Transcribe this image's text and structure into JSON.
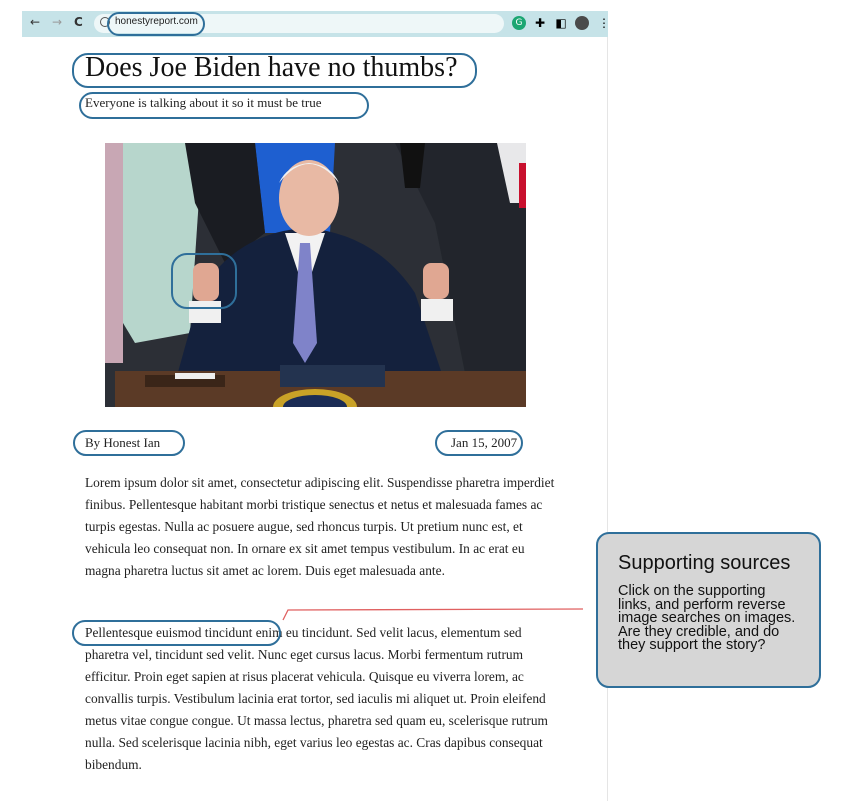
{
  "browser": {
    "url": "honestyreport.com",
    "back_icon": "←",
    "forward_icon": "→",
    "reload_icon": "C"
  },
  "article": {
    "title": "Does Joe Biden have no thumbs?",
    "subtitle": "Everyone is talking about it so it must be true",
    "byline": "By Honest Ian",
    "date": "Jan 15, 2007",
    "paragraph_1": "Lorem ipsum dolor sit amet, consectetur adipiscing elit. Suspendisse pharetra imperdiet finibus. Pellentesque habitant morbi tristique senectus et netus et malesuada fames ac turpis egestas. Nulla ac posuere augue, sed rhoncus turpis. Ut pretium nunc est, et vehicula leo consequat non. In ornare ex sit amet tempus vestibulum. In ac erat eu magna pharetra luctus sit amet ac lorem. Duis eget malesuada ante.",
    "paragraph_2_link": "Pellentesque euismod tincidunt",
    "paragraph_2_rest": " enim eu tincidunt. Sed velit lacus, elementum sed pharetra vel, tincidunt sed velit. Nunc eget cursus lacus. Morbi fermentum rutrum efficitur. Proin eget sapien at risus placerat vehicula. Quisque eu viverra lorem, ac convallis turpis. Vestibulum lacinia erat tortor, sed iaculis mi aliquet ut. Proin eleifend metus vitae congue congue. Ut massa lectus, pharetra sed quam eu, scelerisque rutrum nulla. Sed scelerisque lacinia nibh, eget varius leo egestas ac. Cras dapibus consequat bibendum."
  },
  "callout": {
    "heading": "Supporting sources",
    "body": "Click on the supporting links, and perform reverse image searches on images. Are they credible, and do they support the story?"
  },
  "colors": {
    "annotation": "#2f6f9a",
    "callout_bg": "#d6d6d6",
    "connector": "#e06060",
    "chrome_bg": "#c6e3e8"
  }
}
